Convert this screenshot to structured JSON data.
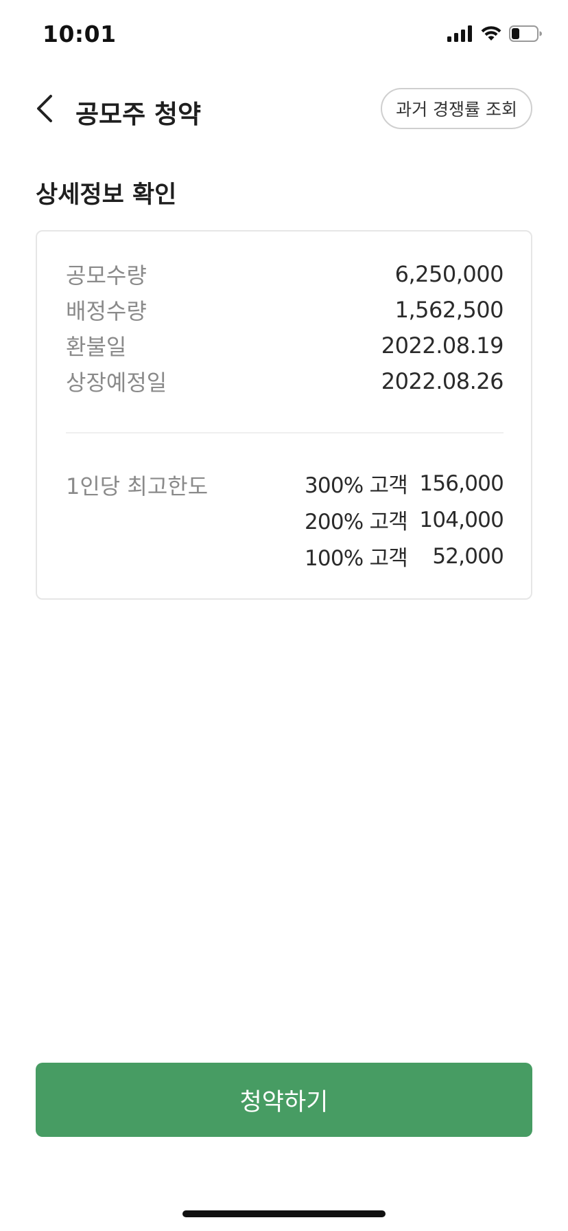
{
  "status_bar": {
    "time": "10:01",
    "icons": [
      "cellular-signal-icon",
      "wifi-icon",
      "battery-icon"
    ]
  },
  "header": {
    "title": "공모주 청약",
    "history_button_label": "과거 경쟁률 조회"
  },
  "section": {
    "title": "상세정보 확인"
  },
  "details": [
    {
      "label": "공모수량",
      "value": "6,250,000"
    },
    {
      "label": "배정수량",
      "value": "1,562,500"
    },
    {
      "label": "환불일",
      "value": "2022.08.19"
    },
    {
      "label": "상장예정일",
      "value": "2022.08.26"
    }
  ],
  "limit": {
    "label": "1인당 최고한도",
    "tiers": [
      {
        "tier": "300% 고객",
        "amount": "156,000"
      },
      {
        "tier": "200% 고객",
        "amount": "104,000"
      },
      {
        "tier": "100% 고객",
        "amount": "52,000"
      }
    ]
  },
  "subscribe_button_label": "청약하기",
  "colors": {
    "primary": "#479c63",
    "label_gray": "#8a8a8a",
    "border": "#e6e6e6"
  }
}
